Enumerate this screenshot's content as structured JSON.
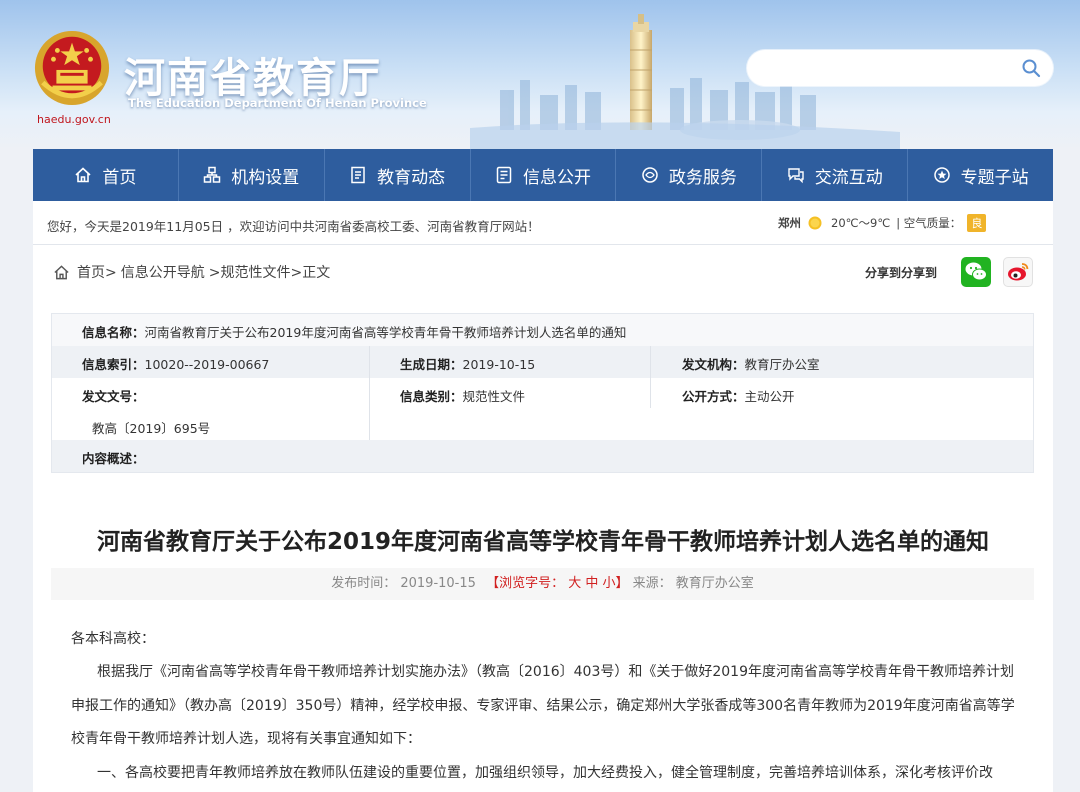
{
  "header": {
    "title": "河南省教育厅",
    "subtitle": "The Education Department Of Henan Province",
    "url": "haedu.gov.cn",
    "search_placeholder": ""
  },
  "nav": {
    "items": [
      {
        "label": "首页",
        "icon": "home-icon"
      },
      {
        "label": "机构设置",
        "icon": "org-icon"
      },
      {
        "label": "教育动态",
        "icon": "news-icon"
      },
      {
        "label": "信息公开",
        "icon": "document-icon"
      },
      {
        "label": "政务服务",
        "icon": "service-icon"
      },
      {
        "label": "交流互动",
        "icon": "chat-icon"
      },
      {
        "label": "专题子站",
        "icon": "topic-icon"
      }
    ]
  },
  "welcome": {
    "text": "您好，今天是2019年11月05日 ，欢迎访问中共河南省委高校工委、河南省教育厅网站！",
    "city": "郑州",
    "temp": "20℃～9℃",
    "aqi_label": "| 空气质量：",
    "aqi_value": "良"
  },
  "breadcrumb": {
    "items": [
      "首页>",
      "信息公开导航",
      ">规范性文件",
      ">正文"
    ]
  },
  "share": {
    "label": "分享到分享到"
  },
  "info": {
    "name_label": "信息名称：",
    "name_value": "河南省教育厅关于公布2019年度河南省高等学校青年骨干教师培养计划人选名单的通知",
    "index_label": "信息索引：",
    "index_value": "10020--2019-00667",
    "date_label": "生成日期：",
    "date_value": "2019-10-15",
    "org_label": "发文机构：",
    "org_value": "教育厅办公室",
    "doc_label": "发文文号：",
    "doc_value": "教高〔2019〕695号",
    "category_label": "信息类别：",
    "category_value": "规范性文件",
    "open_label": "公开方式：",
    "open_value": "主动公开",
    "summary_label": "内容概述："
  },
  "article": {
    "title": "河南省教育厅关于公布2019年度河南省高等学校青年骨干教师培养计划人选名单的通知",
    "meta_date": "发布时间：  2019-10-15",
    "meta_font": "【浏览字号：  大  中  小】",
    "meta_source": "来源：  教育厅办公室",
    "paragraphs": [
      "各本科高校：",
      "根据我厅《河南省高等学校青年骨干教师培养计划实施办法》（教高〔2016〕403号）和《关于做好2019年度河南省高等学校青年骨干教师培养计划",
      "申报工作的通知》（教办高〔2019〕350号）精神，经学校申报、专家评审、结果公示，确定郑州大学张香成等300名青年教师为2019年度河南省高等学",
      "校青年骨干教师培养计划人选，现将有关事宜通知如下：",
      "一、各高校要把青年教师培养放在教师队伍建设的重要位置，加强组织领导，加大经费投入，健全管理制度，完善培养培训体系，深化考核评价改"
    ]
  }
}
